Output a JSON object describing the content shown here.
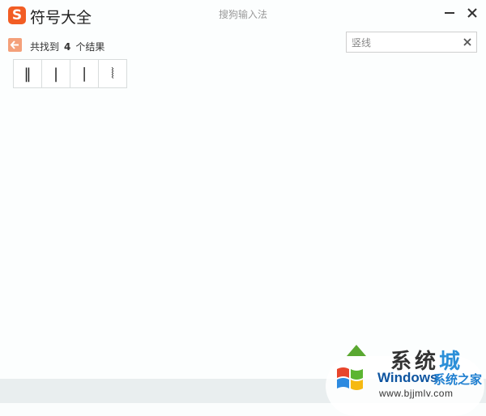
{
  "window": {
    "app_title": "符号大全",
    "ime_name": "搜狗输入法",
    "logo_letter": "S"
  },
  "results": {
    "prefix": "共找到",
    "count": "4",
    "suffix": "个结果"
  },
  "search": {
    "value": "竖线",
    "placeholder": "竖线"
  },
  "symbols": [
    "‖",
    "|",
    "∣",
    "⦚"
  ],
  "watermark": {
    "brand_big_1": "系统",
    "brand_big_2": "城",
    "windows": "Windows",
    "cn": "系统之家",
    "url": "www.bjjmlv.com"
  },
  "colors": {
    "accent_orange": "#f25d24",
    "back_button": "#f4a07a",
    "watermark_blue": "#1f7fd0",
    "watermark_green": "#5aa831"
  },
  "icons": {
    "logo": "sogou-logo-icon",
    "minimize": "minimize-icon",
    "close": "close-icon",
    "back": "arrow-left-icon",
    "clear": "clear-x-icon"
  }
}
